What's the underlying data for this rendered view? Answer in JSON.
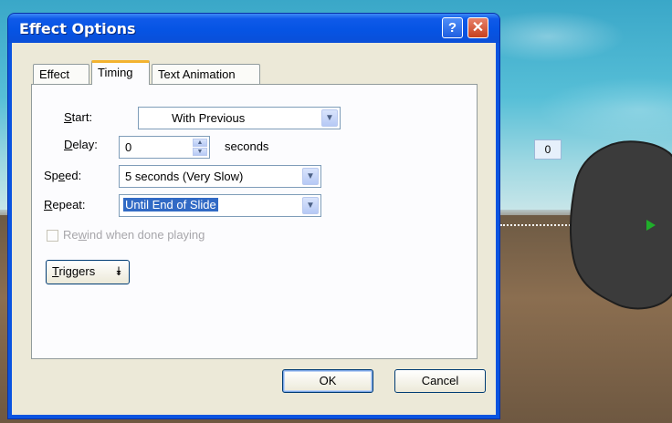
{
  "dialog": {
    "title": "Effect Options",
    "help_glyph": "?",
    "close_glyph": "✕"
  },
  "tabs": [
    {
      "label": "Effect",
      "active": false
    },
    {
      "label": "Timing",
      "active": true
    },
    {
      "label": "Text Animation",
      "active": false
    }
  ],
  "timing": {
    "start_label_mnemonic": "S",
    "start_label_rest": "tart:",
    "start_value": "With Previous",
    "delay_label_mnemonic": "D",
    "delay_label_rest": "elay:",
    "delay_value": "0",
    "delay_unit": "seconds",
    "speed_label_pre": "Sp",
    "speed_label_mnemonic": "e",
    "speed_label_rest": "ed:",
    "speed_value": "5 seconds (Very Slow)",
    "repeat_label_mnemonic": "R",
    "repeat_label_rest": "epeat:",
    "repeat_value": "Until End of Slide",
    "rewind_pre": "Re",
    "rewind_mnemonic": "w",
    "rewind_rest": "ind when done playing",
    "rewind_checked": false,
    "triggers_mnemonic": "T",
    "triggers_rest": "riggers",
    "triggers_chevron": "⯯"
  },
  "buttons": {
    "ok": "OK",
    "cancel": "Cancel"
  },
  "slide": {
    "badge": "0"
  },
  "icons": {
    "combo_arrow": "chevron-down-icon",
    "spin": "spin-arrows-icon"
  },
  "colors": {
    "titlebar": "#0a54e0",
    "dialog_face": "#ece9d8",
    "selection": "#316ac5",
    "tab_accent": "#f3b330"
  }
}
